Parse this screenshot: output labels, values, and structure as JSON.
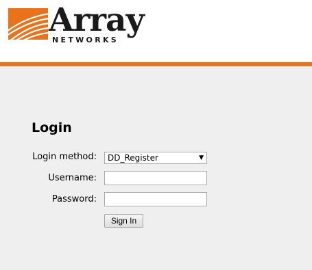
{
  "brand": {
    "name": "Array",
    "subtitle": "NETWORKS",
    "logo_icon": "array-networks-swoosh-logo",
    "text_color": "#1a1a1a",
    "accent_color": "#e8731a"
  },
  "login": {
    "title": "Login",
    "method_label": "Login method:",
    "method_value": "DD_Register",
    "username_label": "Username:",
    "username_value": "",
    "password_label": "Password:",
    "password_value": "",
    "submit_label": "Sign In"
  }
}
